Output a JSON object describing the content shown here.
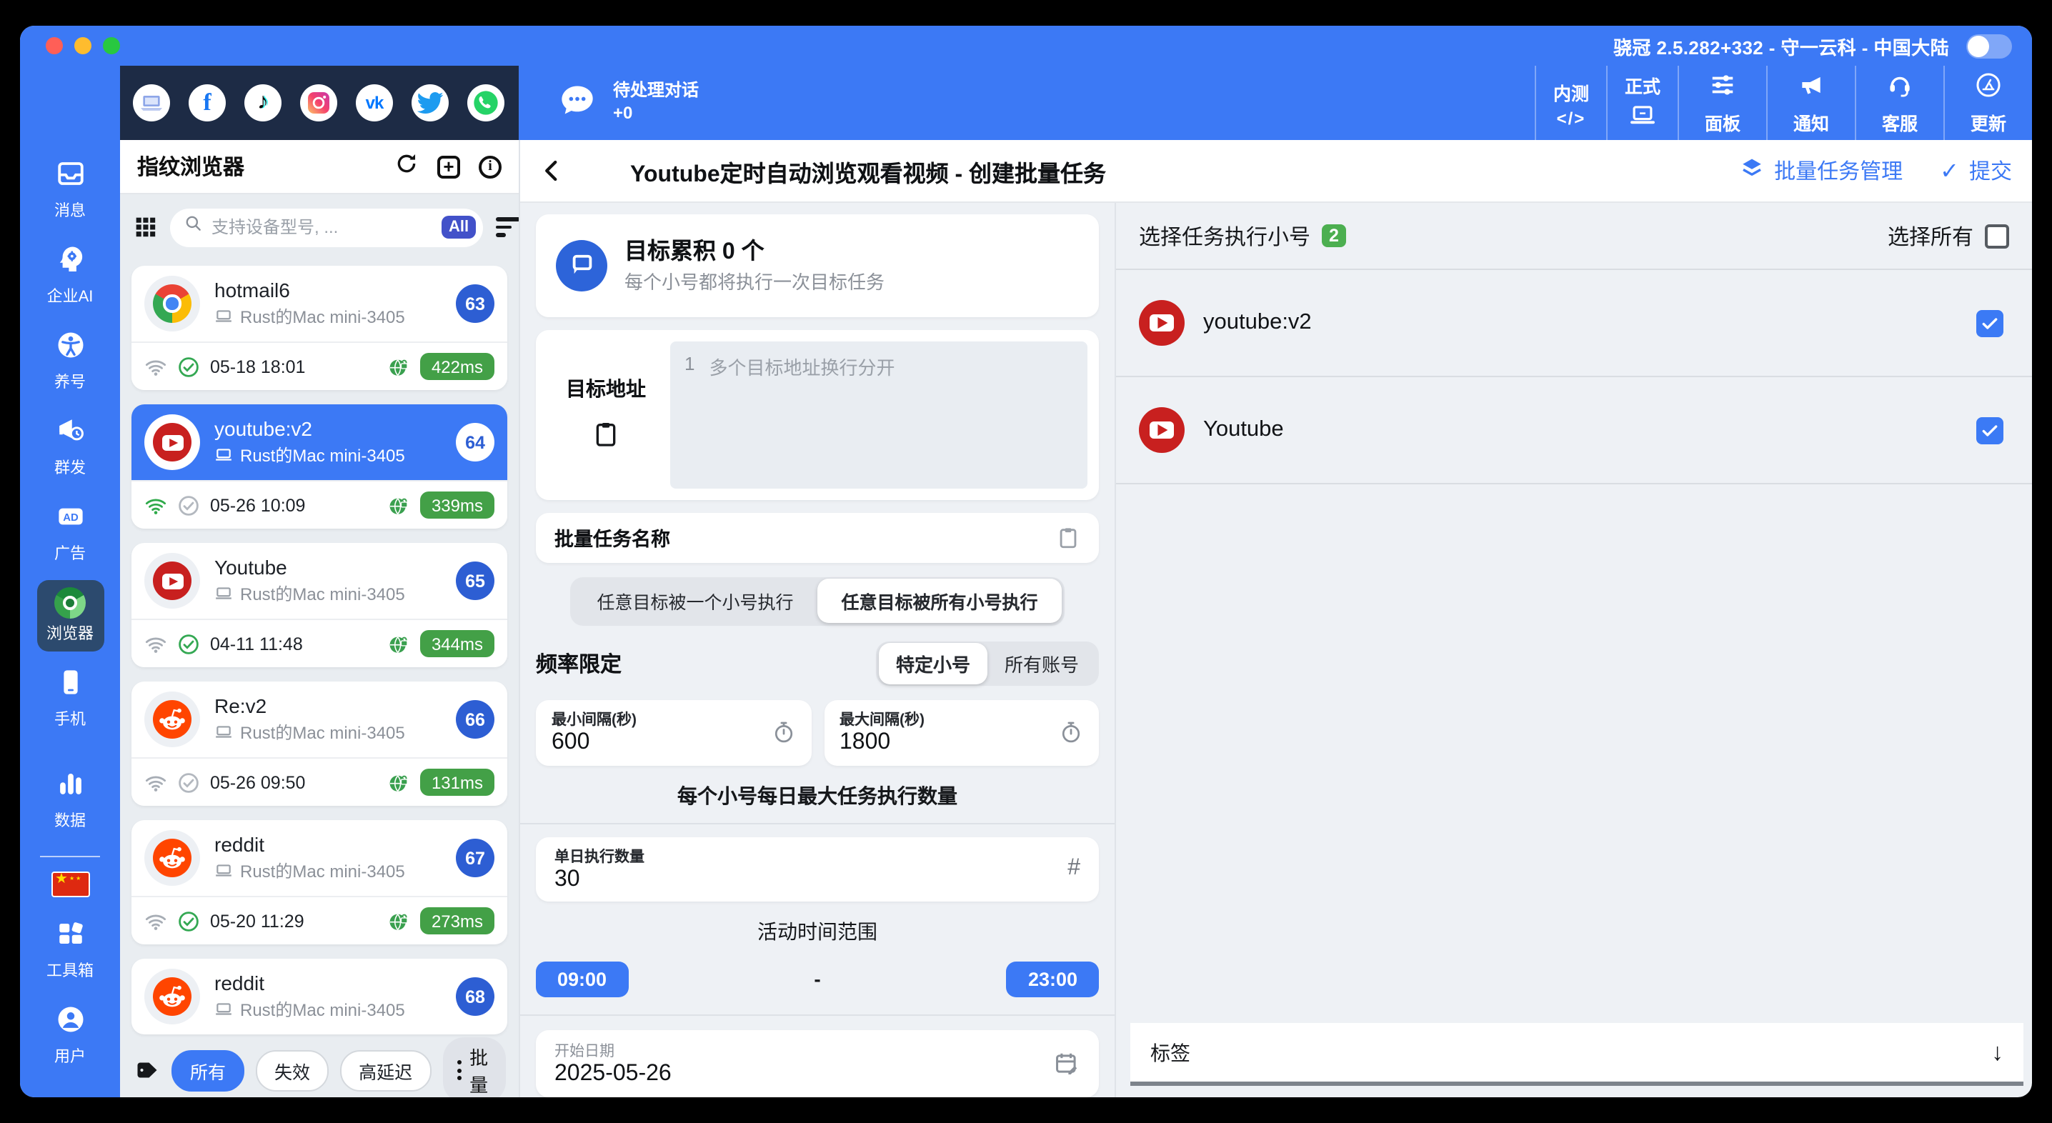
{
  "titlebar": {
    "title": "骁冠 2.5.282+332 - 守一云科 - 中国大陆"
  },
  "topbar": {
    "chat_label": "待处理对话",
    "chat_count": "+0",
    "buttons": [
      {
        "label": "内测",
        "icon_text": "</>"
      },
      {
        "label": "正式"
      },
      {
        "label": "面板"
      },
      {
        "label": "通知"
      },
      {
        "label": "客服"
      },
      {
        "label": "更新"
      }
    ]
  },
  "sidebar": {
    "items": [
      {
        "label": "消息"
      },
      {
        "label": "企业AI"
      },
      {
        "label": "养号"
      },
      {
        "label": "群发"
      },
      {
        "label": "广告"
      },
      {
        "label": "浏览器"
      },
      {
        "label": "手机"
      },
      {
        "label": "数据"
      },
      {
        "label": "工具箱"
      },
      {
        "label": "用户"
      }
    ]
  },
  "profiles": {
    "title": "指纹浏览器",
    "search": {
      "placeholder": "支持设备型号, ...",
      "badge": "All"
    },
    "items": [
      {
        "name": "hotmail6",
        "device": "Rust的Mac mini-3405",
        "number": "63",
        "last_time": "05-18 18:01",
        "latency": "422ms"
      },
      {
        "name": "youtube:v2",
        "device": "Rust的Mac mini-3405",
        "number": "64",
        "last_time": "05-26 10:09",
        "latency": "339ms"
      },
      {
        "name": "Youtube",
        "device": "Rust的Mac mini-3405",
        "number": "65",
        "last_time": "04-11 11:48",
        "latency": "344ms"
      },
      {
        "name": "Re:v2",
        "device": "Rust的Mac mini-3405",
        "number": "66",
        "last_time": "05-26 09:50",
        "latency": "131ms"
      },
      {
        "name": "reddit",
        "device": "Rust的Mac mini-3405",
        "number": "67",
        "last_time": "05-20 11:29",
        "latency": "273ms"
      },
      {
        "name": "reddit",
        "device": "Rust的Mac mini-3405",
        "number": "68"
      }
    ],
    "filters": {
      "all": "所有",
      "invalid": "失效",
      "high_latency": "高延迟",
      "batch": "批量"
    }
  },
  "main": {
    "title": "Youtube定时自动浏览观看视频 - 创建批量任务",
    "manage_label": "批量任务管理",
    "submit_label": "提交",
    "submit_check": "✓",
    "summary_title": "目标累积 0 个",
    "summary_subtitle": "每个小号都将执行一次目标任务",
    "address_label": "目标地址",
    "address_line_number": "1",
    "address_placeholder": "多个目标地址换行分开",
    "task_name_label": "批量任务名称",
    "mode_option_one": "任意目标被一个小号执行",
    "mode_option_all": "任意目标被所有小号执行",
    "frequency_label": "频率限定",
    "frequency_specific": "特定小号",
    "frequency_all": "所有账号",
    "min_interval_label": "最小间隔(秒)",
    "min_interval_value": "600",
    "max_interval_label": "最大间隔(秒)",
    "max_interval_value": "1800",
    "daily_max_title": "每个小号每日最大任务执行数量",
    "daily_count_label": "单日执行数量",
    "daily_count_value": "30",
    "hash_icon_text": "#",
    "time_range_title": "活动时间范围",
    "time_start": "09:00",
    "time_dash": "-",
    "time_end": "23:00",
    "start_date_label": "开始日期",
    "start_date_value": "2025-05-26",
    "arrow_down": "↓"
  },
  "right": {
    "title": "选择任务执行小号",
    "count": "2",
    "select_all_label": "选择所有",
    "accounts": [
      {
        "name": "youtube:v2"
      },
      {
        "name": "Youtube"
      }
    ],
    "tags_label": "标签"
  },
  "colors": {
    "accent_blue": "#3c79f5",
    "badge_blue": "#2d5ed3",
    "latency_green": "#43a047",
    "badge_green": "#4caf50",
    "dark_navy": "#1d2b45",
    "youtube_red": "#c8201f",
    "reddit_orange": "#ff4500",
    "all_badge_indigo": "#4251c9"
  }
}
